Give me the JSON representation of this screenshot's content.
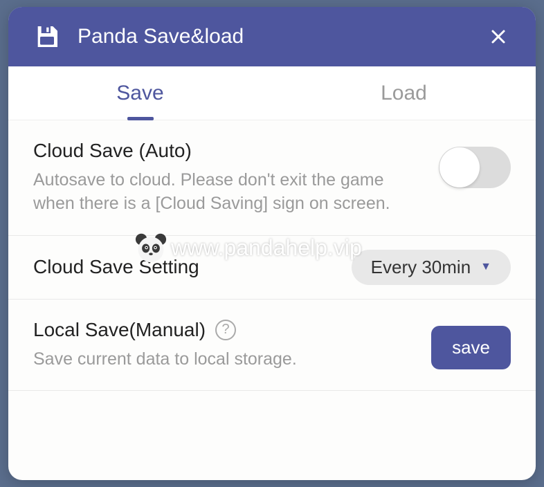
{
  "header": {
    "title": "Panda Save&load"
  },
  "tabs": {
    "save": "Save",
    "load": "Load"
  },
  "cloud_auto": {
    "title": "Cloud Save (Auto)",
    "subtitle": "Autosave to cloud. Please don't exit the game when there is a [Cloud Saving] sign on screen."
  },
  "cloud_setting": {
    "label": "Cloud Save Setting",
    "value": "Every 30min"
  },
  "local_save": {
    "title": "Local Save(Manual)",
    "subtitle": "Save current data to local storage.",
    "button": "save"
  },
  "watermark": {
    "text": "www.pandahelp.vip"
  }
}
